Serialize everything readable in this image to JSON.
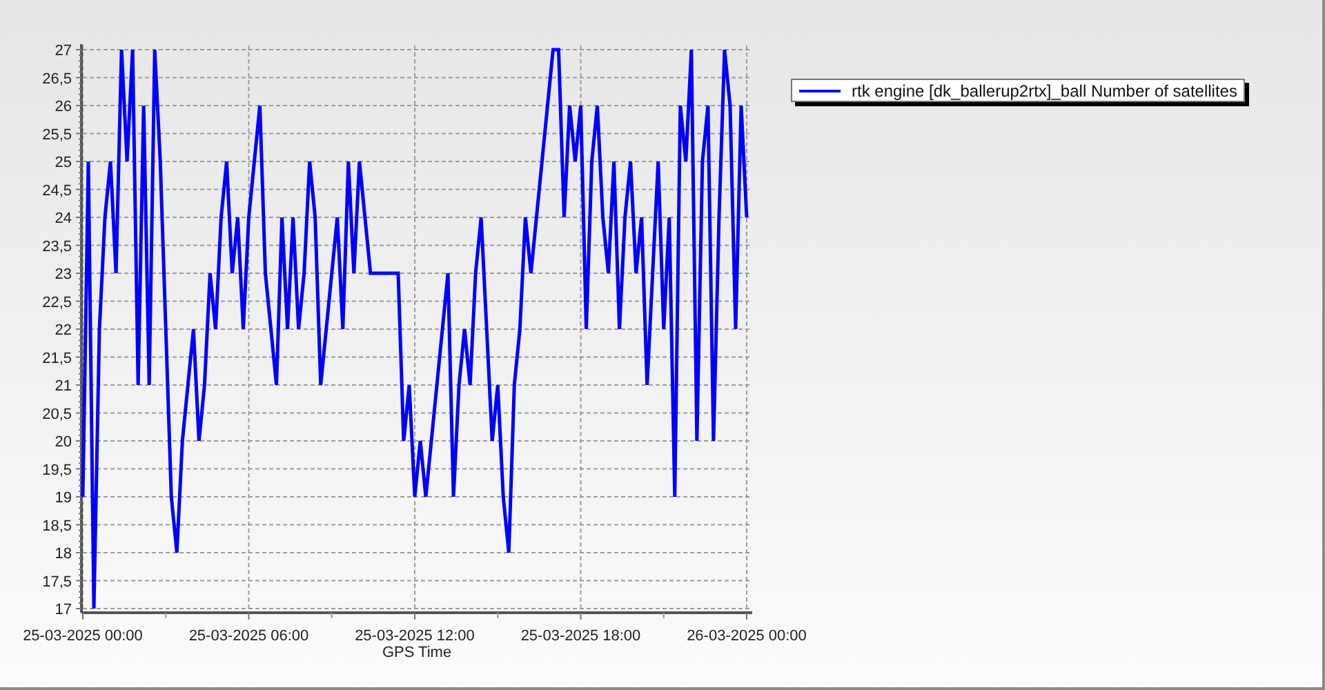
{
  "chart": {
    "chart_data": {
      "type": "line",
      "xlabel": "GPS Time",
      "grid": true,
      "ylim": [
        17,
        27
      ],
      "yticks": [
        {
          "value": 17,
          "label": "17"
        },
        {
          "value": 17.5,
          "label": "17,5"
        },
        {
          "value": 18,
          "label": "18"
        },
        {
          "value": 18.5,
          "label": "18,5"
        },
        {
          "value": 19,
          "label": "19"
        },
        {
          "value": 19.5,
          "label": "19,5"
        },
        {
          "value": 20,
          "label": "20"
        },
        {
          "value": 20.5,
          "label": "20,5"
        },
        {
          "value": 21,
          "label": "21"
        },
        {
          "value": 21.5,
          "label": "21,5"
        },
        {
          "value": 22,
          "label": "22"
        },
        {
          "value": 22.5,
          "label": "22,5"
        },
        {
          "value": 23,
          "label": "23"
        },
        {
          "value": 23.5,
          "label": "23,5"
        },
        {
          "value": 24,
          "label": "24"
        },
        {
          "value": 24.5,
          "label": "24,5"
        },
        {
          "value": 25,
          "label": "25"
        },
        {
          "value": 25.5,
          "label": "25,5"
        },
        {
          "value": 26,
          "label": "26"
        },
        {
          "value": 26.5,
          "label": "26,5"
        },
        {
          "value": 27,
          "label": "27"
        }
      ],
      "categories": [
        "25-03-2025 00:00",
        null,
        null,
        null,
        null,
        null,
        null,
        null,
        null,
        null,
        null,
        null,
        null,
        null,
        null,
        null,
        null,
        null,
        null,
        null,
        null,
        null,
        null,
        null,
        null,
        null,
        null,
        null,
        null,
        null,
        "25-03-2025 06:00",
        null,
        null,
        null,
        null,
        null,
        null,
        null,
        null,
        null,
        null,
        null,
        null,
        null,
        null,
        null,
        null,
        null,
        null,
        null,
        null,
        null,
        null,
        null,
        null,
        null,
        null,
        null,
        null,
        null,
        "25-03-2025 12:00",
        null,
        null,
        null,
        null,
        null,
        null,
        null,
        null,
        null,
        null,
        null,
        null,
        null,
        null,
        null,
        null,
        null,
        null,
        null,
        null,
        null,
        null,
        null,
        null,
        null,
        null,
        null,
        null,
        null,
        "25-03-2025 18:00",
        null,
        null,
        null,
        null,
        null,
        null,
        null,
        null,
        null,
        null,
        null,
        null,
        null,
        null,
        null,
        null,
        null,
        null,
        null,
        null,
        null,
        null,
        null,
        null,
        null,
        null,
        null,
        null,
        null,
        "26-03-2025 00:00"
      ],
      "series": [
        {
          "name": "rtk engine [dk_ballerup2rtx]_ball Number of satellites",
          "color": "#0000ff",
          "values": [
            19,
            25,
            17,
            22,
            24,
            25,
            23,
            27,
            25,
            27,
            21,
            26,
            21,
            27,
            25,
            22,
            19,
            18,
            20,
            21,
            22,
            20,
            21,
            23,
            22,
            24,
            25,
            23,
            24,
            22,
            24,
            25,
            26,
            23,
            22,
            21,
            24,
            22,
            24,
            22,
            23,
            25,
            24,
            21,
            22,
            23,
            24,
            22,
            25,
            23,
            25,
            24,
            23,
            23,
            23,
            23,
            23,
            23,
            20,
            21,
            19,
            20,
            19,
            20,
            21,
            22,
            23,
            19,
            21,
            22,
            21,
            23,
            24,
            22,
            20,
            21,
            19,
            18,
            21,
            22,
            24,
            23,
            24,
            25,
            26,
            27,
            27,
            24,
            26,
            25,
            26,
            22,
            25,
            26,
            24,
            23,
            25,
            22,
            24,
            25,
            23,
            24,
            21,
            23,
            25,
            22,
            24,
            19,
            26,
            25,
            27,
            20,
            25,
            26,
            20,
            24,
            27,
            26,
            22,
            26,
            24
          ]
        }
      ]
    }
  }
}
